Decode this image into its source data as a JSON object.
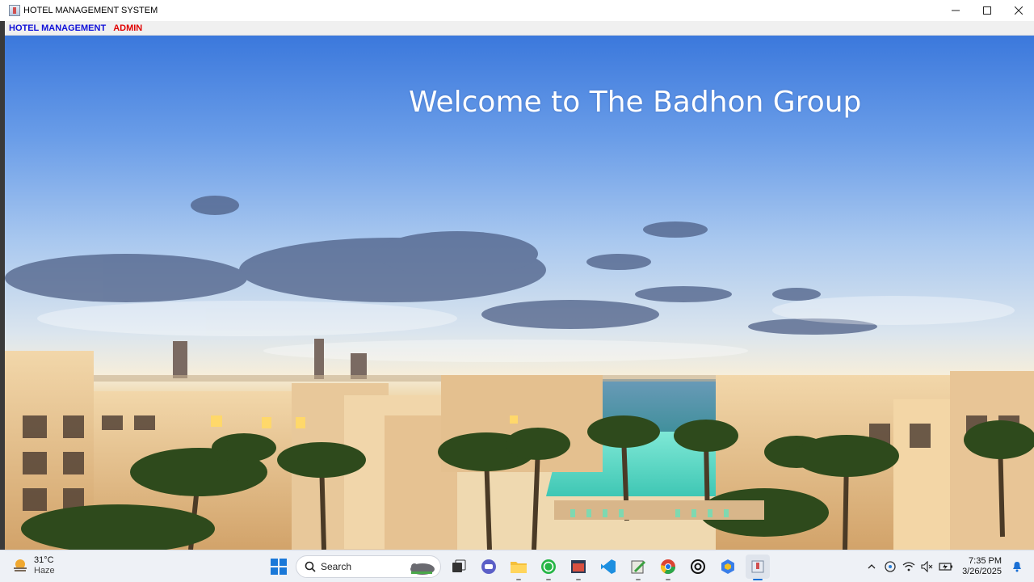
{
  "window": {
    "title": "HOTEL MANAGEMENT SYSTEM"
  },
  "menubar": {
    "items": [
      {
        "label": "HOTEL MANAGEMENT",
        "color": "#1010d8"
      },
      {
        "label": "ADMIN",
        "color": "#e00000"
      }
    ]
  },
  "main": {
    "welcome_text": "Welcome to The Badhon Group",
    "background_image": "hotel-resort-panorama"
  },
  "taskbar": {
    "weather": {
      "temperature": "31°C",
      "condition": "Haze"
    },
    "search_placeholder": "Search",
    "pinned_apps": [
      "start-icon",
      "search-icon",
      "task-view-icon",
      "teams-chat-icon",
      "file-explorer-icon",
      "whatsapp-icon",
      "app-window-icon",
      "vscode-icon",
      "editor-icon",
      "chrome-icon",
      "chatgpt-icon",
      "app-cube-icon",
      "java-app-icon"
    ],
    "clock": {
      "time": "7:35 PM",
      "date": "3/26/2025"
    }
  },
  "colors": {
    "accent": "#1a6fd4",
    "menu_hotel": "#1010d8",
    "menu_admin": "#e00000"
  }
}
